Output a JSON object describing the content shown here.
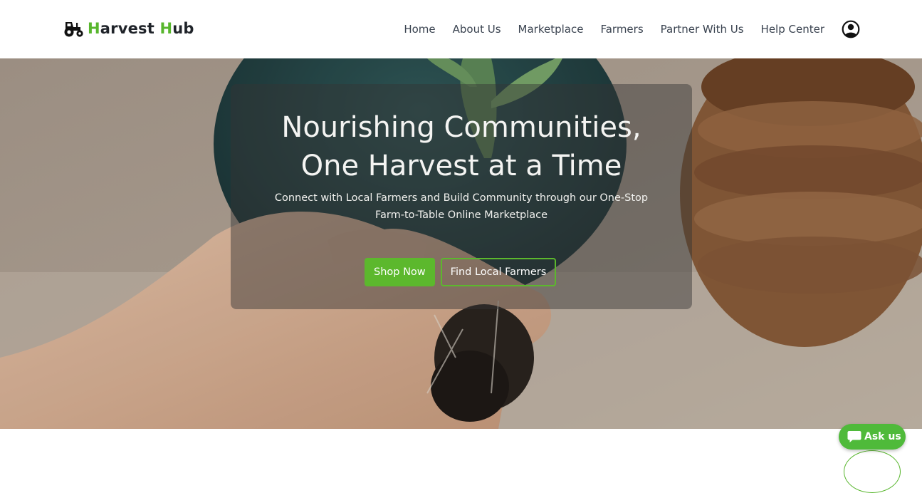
{
  "brand": {
    "icon": "tractor-icon",
    "name_initial_1": "H",
    "name_rest_1": "arvest ",
    "name_initial_2": "H",
    "name_rest_2": "ub",
    "accent_color": "#58b62d"
  },
  "nav": {
    "items": [
      {
        "label": "Home"
      },
      {
        "label": "About Us"
      },
      {
        "label": "Marketplace"
      },
      {
        "label": "Farmers"
      },
      {
        "label": "Partner With Us"
      },
      {
        "label": "Help Center"
      }
    ],
    "user_icon": "user-circle-icon"
  },
  "hero": {
    "title_line_1": "Nourishing Communities,",
    "title_line_2": "One Harvest at a Time",
    "subtitle_line_1": "Connect with Local Farmers and Build Community through our One-Stop",
    "subtitle_line_2": "Farm-to-Table Online Marketplace",
    "primary_button": "Shop Now",
    "secondary_button": "Find Local Farmers",
    "button_color": "#5cb82d"
  },
  "chat_widget": {
    "icon": "chat-bubble-icon",
    "label": "Ask us",
    "color": "#4fba3a"
  }
}
